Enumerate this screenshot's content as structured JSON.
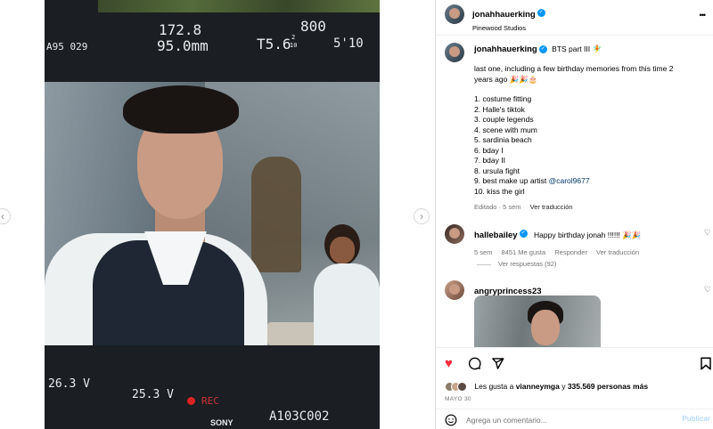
{
  "media": {
    "hud": {
      "reel": "A95 029",
      "focal_top": "172.8",
      "focal_mm": "95.0mm",
      "iso": "800",
      "stop": "T5.6",
      "stop_frac_top": "2",
      "stop_frac_bottom": "10",
      "dist": "5'10",
      "voltage_left": "26.3 V",
      "voltage_mid": "25.3 V",
      "rec": "REC",
      "brand": "SONY",
      "clip": "A103C002"
    },
    "prev_arrow": "‹",
    "next_arrow": "›"
  },
  "header": {
    "username": "jonahhauerking",
    "location": "Pinewood Studios",
    "more": "•••",
    "verified_icon": "verified-badge-icon"
  },
  "caption": {
    "username": "jonahhauerking",
    "title": "BTS part III 🧚",
    "intro": "last one, including a few birthday memories from this time 2 years ago 🎉🎉🎂",
    "items": [
      "1. costume fitting",
      "2. Halle's tiktok",
      "3. couple legends",
      "4. scene with mum",
      "5. sardinia beach",
      "6. bday I",
      "7. bday II",
      "8. ursula fight",
      "9. best make up artist ",
      "10. kiss the girl"
    ],
    "mention": "@carol9677",
    "edited": "Editado · 5 sem",
    "translate": "Ver traducción"
  },
  "comments": [
    {
      "username": "hallebailey",
      "text": "Happy birthday jonah !!!!!! 🎉🎉",
      "age": "5 sem",
      "likes": "8451 Me gusta",
      "reply": "Responder",
      "translate": "Ver traducción",
      "replies": "Ver respuestas (92)"
    },
    {
      "username": "angryprincess23"
    }
  ],
  "actions": {
    "liked_by_prefix": "Les gusta a ",
    "liked_by_user": "vianneymga",
    "liked_by_mid": " y ",
    "liked_by_count": "335.569 personas más",
    "date": "MAYO 30",
    "add_comment_placeholder": "Agrega un comentario...",
    "publish": "Publicar"
  },
  "colors": {
    "accent": "#0095f6",
    "like_red": "#ff3040",
    "link": "#00376b",
    "muted": "#737373"
  }
}
